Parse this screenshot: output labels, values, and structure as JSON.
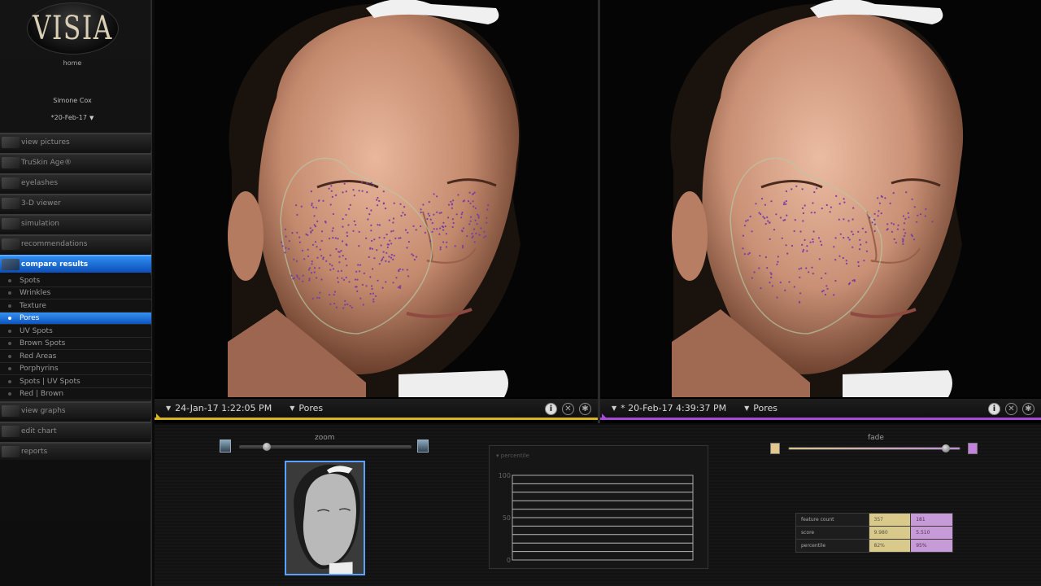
{
  "app": {
    "logo_text": "VISIA",
    "home_label": "home",
    "patient_name": "Simone Cox",
    "visit_date": "*20-Feb-17"
  },
  "nav": {
    "items": [
      {
        "label": "view pictures"
      },
      {
        "label": "TruSkin Age®"
      },
      {
        "label": "eyelashes"
      },
      {
        "label": "3-D viewer"
      },
      {
        "label": "simulation"
      },
      {
        "label": "recommendations"
      },
      {
        "label": "compare results"
      }
    ],
    "sub_items": [
      {
        "label": "Spots"
      },
      {
        "label": "Wrinkles"
      },
      {
        "label": "Texture"
      },
      {
        "label": "Pores"
      },
      {
        "label": "UV Spots"
      },
      {
        "label": "Brown Spots"
      },
      {
        "label": "Red Areas"
      },
      {
        "label": "Porphyrins"
      },
      {
        "label": "Spots | UV Spots"
      },
      {
        "label": "Red | Brown"
      }
    ],
    "bottom_items": [
      {
        "label": "view graphs"
      },
      {
        "label": "edit chart"
      },
      {
        "label": "reports"
      }
    ],
    "active_item": "compare results",
    "active_sub_item": "Pores"
  },
  "panels": {
    "left": {
      "date": "24-Jan-17 1:22:05 PM",
      "mode": "Pores",
      "accent": "#d8b422"
    },
    "right": {
      "date": "* 20-Feb-17 4:39:37 PM",
      "mode": "Pores",
      "accent": "#a54ad4"
    }
  },
  "controls": {
    "zoom_label": "zoom",
    "fade_label": "fade",
    "zoom_level": 0.14,
    "fade_level": 0.94
  },
  "chart_data": {
    "type": "bar",
    "title": "percentile",
    "categories": [],
    "values": [],
    "ylim": [
      0,
      100
    ],
    "yticks": [
      "100",
      "50",
      "0"
    ],
    "grid": true
  },
  "scores": {
    "rows": [
      {
        "label": "feature count",
        "v1": "357",
        "v2": "181"
      },
      {
        "label": "score",
        "v1": "9.980",
        "v2": "5.510"
      },
      {
        "label": "percentile",
        "v1": "82%",
        "v2": "95%"
      }
    ]
  },
  "icons": {
    "info": "info-icon",
    "close": "close-icon",
    "settings": "gear-icon"
  }
}
